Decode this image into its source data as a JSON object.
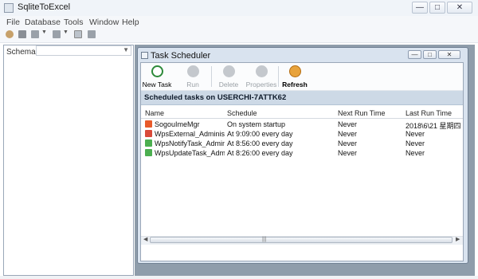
{
  "window": {
    "title": "SqliteToExcel"
  },
  "controls": {
    "minimize": "—",
    "maximize": "□",
    "close": "✕"
  },
  "menu": [
    "File",
    "Database",
    "Tools",
    "Window",
    "Help"
  ],
  "schema": {
    "label": "Schema",
    "value": ""
  },
  "child_window": {
    "title": "Task Scheduler"
  },
  "toolbar": {
    "new_task": "New Task",
    "run": "Run",
    "delete": "Delete",
    "properties": "Properties",
    "refresh": "Refresh"
  },
  "header_text": "Scheduled tasks on USERCHI-7ATTK62",
  "columns": [
    "Name",
    "Schedule",
    "Next Run Time",
    "Last Run Time"
  ],
  "rows": [
    {
      "name": "SogouImeMgr",
      "schedule": "On system startup",
      "next": "Never",
      "last": "2018\\6\\21 星期四 ..."
    },
    {
      "name": "WpsExternal_Administ...",
      "schedule": "At 9:09:00 every day",
      "next": "Never",
      "last": "Never"
    },
    {
      "name": "WpsNotifyTask_Admini...",
      "schedule": "At 8:56:00 every day",
      "next": "Never",
      "last": "Never"
    },
    {
      "name": "WpsUpdateTask_Admi...",
      "schedule": "At 8:26:00 every day",
      "next": "Never",
      "last": "Never"
    }
  ],
  "icon_colors": {
    "sogou": "#e85a2a",
    "wps_external": "#d94a3a",
    "wps_notify": "#4caf50",
    "wps_update": "#4caf50"
  }
}
